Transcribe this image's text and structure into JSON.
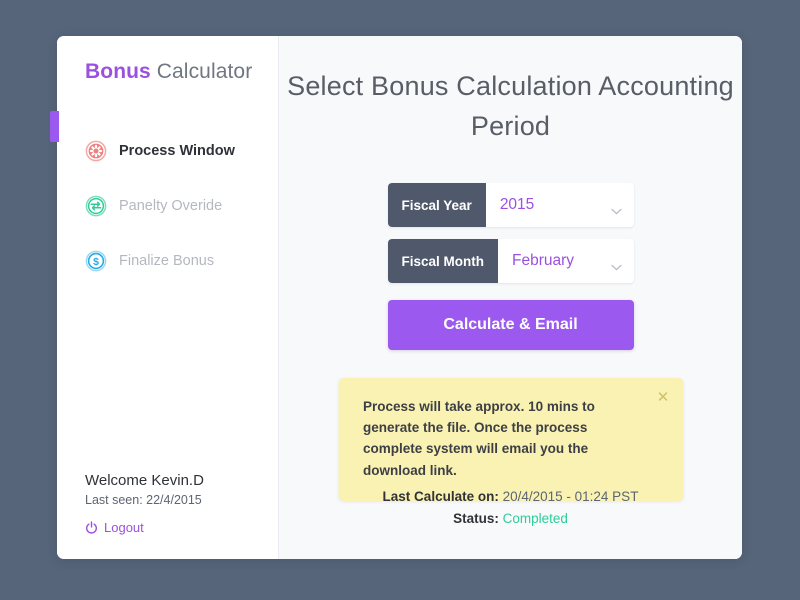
{
  "brand": {
    "strong": "Bonus",
    "rest": " Calculator"
  },
  "sidebar": {
    "items": [
      {
        "label": "Process Window",
        "icon": "gear-circle-icon",
        "color": "#f08080",
        "active": true
      },
      {
        "label": "Panelty Overide",
        "icon": "sync-circle-icon",
        "color": "#2ecc9b",
        "active": false
      },
      {
        "label": "Finalize Bonus",
        "icon": "dollar-circle-icon",
        "color": "#29abe2",
        "active": false
      }
    ],
    "footer": {
      "welcome": "Welcome Kevin.D",
      "last_seen": "Last seen: 22/4/2015",
      "logout_label": "Logout",
      "logout_icon": "power-icon"
    }
  },
  "main": {
    "title": "Select Bonus Calculation Accounting Period",
    "form": {
      "fields": [
        {
          "tag": "Fiscal Year",
          "value": "2015",
          "icon": "chevron-down-icon"
        },
        {
          "tag": "Fiscal Month",
          "value": "February",
          "icon": "chevron-down-icon"
        }
      ],
      "submit_label": "Calculate & Email"
    },
    "notification": {
      "text": "Process will take approx. 10 mins to generate the file. Once the process complete system will email you the download link.",
      "close_icon": "close-icon"
    },
    "status": {
      "last_calculate_label": "Last Calculate on:",
      "last_calculate_value": "20/4/2015 - 01:24 PST",
      "status_label": "Status:",
      "status_value": "Completed"
    }
  },
  "colors": {
    "page_background": "#566579",
    "accent_purple": "#9b51e0",
    "button_purple": "#9b59f0",
    "select_tag_dark": "#50596b",
    "notification_yellow": "#faf2b2",
    "status_green": "#2ecc9b"
  }
}
